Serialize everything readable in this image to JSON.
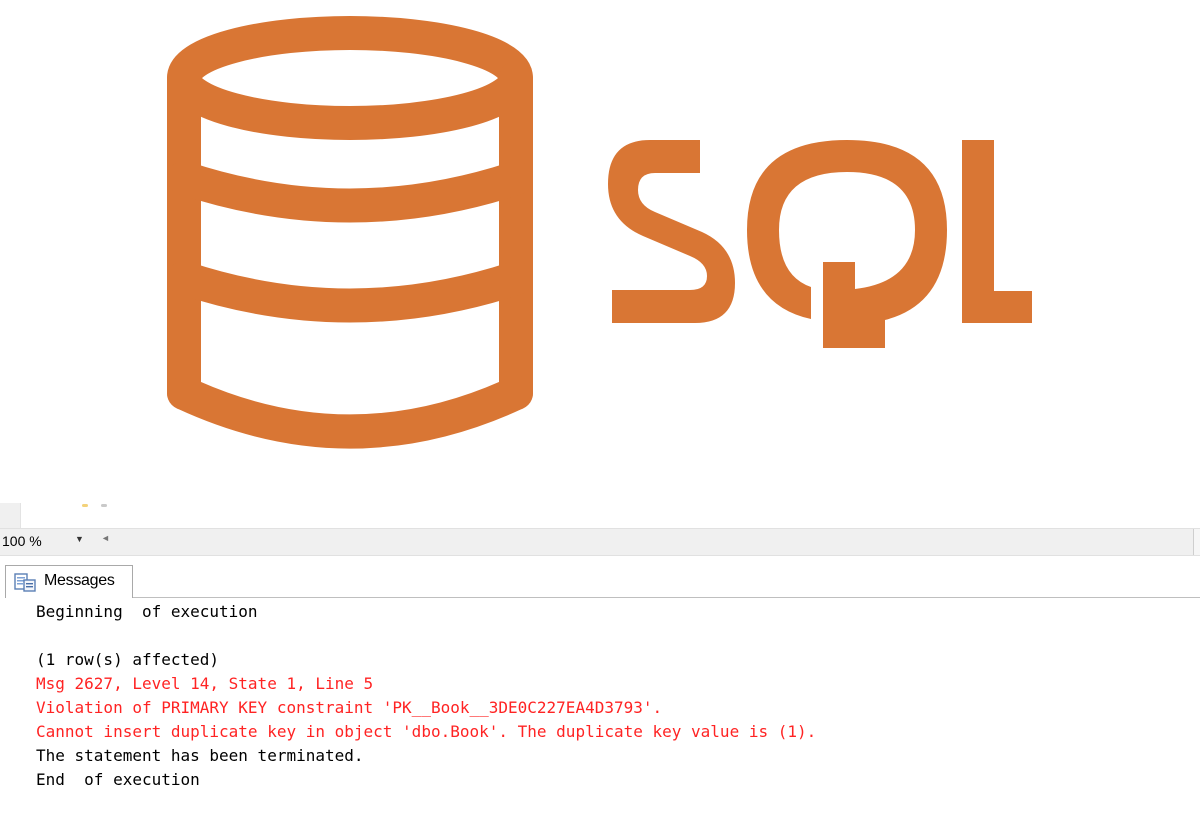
{
  "logo": {
    "text": "SQL",
    "color": "#d97634",
    "icon": "database-icon"
  },
  "toolbar": {
    "zoom_value": "100 %",
    "zoom_dropdown_icon": "dropdown-arrow-icon",
    "scroll_icon": "scroll-left-icon"
  },
  "tabs": [
    {
      "label": "Messages",
      "icon": "messages-icon",
      "active": true
    }
  ],
  "messages": [
    {
      "text": "Beginning  of execution",
      "color": "black"
    },
    {
      "text": "",
      "color": "black"
    },
    {
      "text": "(1 row(s) affected)",
      "color": "black"
    },
    {
      "text": "Msg 2627, Level 14, State 1, Line 5",
      "color": "red"
    },
    {
      "text": "Violation of PRIMARY KEY constraint 'PK__Book__3DE0C227EA4D3793'.",
      "color": "red"
    },
    {
      "text": "Cannot insert duplicate key in object 'dbo.Book'. The duplicate key value is (1).",
      "color": "red"
    },
    {
      "text": "The statement has been terminated.",
      "color": "black"
    },
    {
      "text": "End  of execution",
      "color": "black"
    }
  ],
  "colors": {
    "error_text": "#ff2323",
    "normal_text": "#000000",
    "logo_orange": "#d97634"
  }
}
